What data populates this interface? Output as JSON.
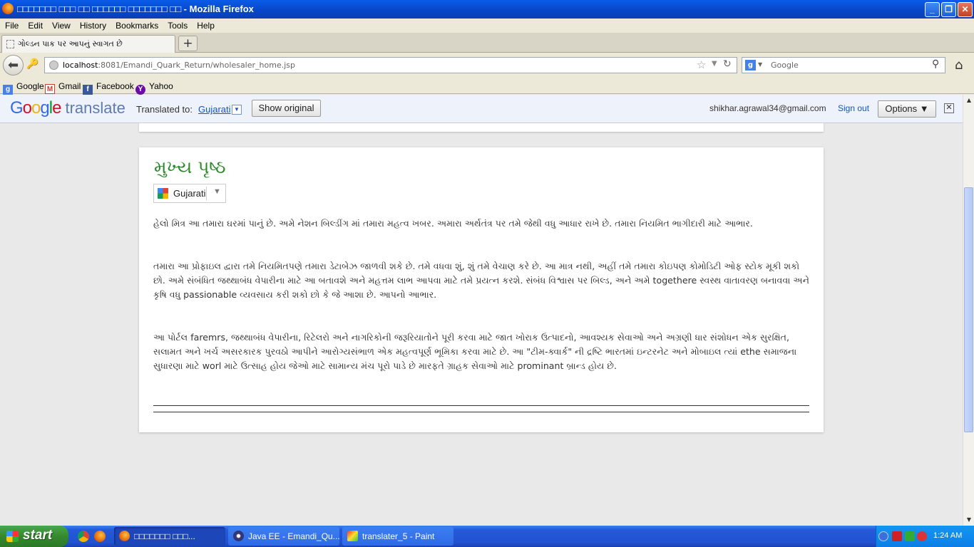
{
  "window": {
    "title": "□□□□□□□ □□□ □□ □□□□□□ □□□□□□□ □□ - Mozilla Firefox"
  },
  "menu": [
    "File",
    "Edit",
    "View",
    "History",
    "Bookmarks",
    "Tools",
    "Help"
  ],
  "tab": {
    "label": "ગોલ્ડન પાક પર આપનું સ્વાગત છે",
    "new_tab": "+"
  },
  "nav": {
    "url_host": "localhost",
    "url_path": ":8081/Emandi_Quark_Return/wholesaler_home.jsp",
    "search_placeholder": "Google"
  },
  "bookmarks": [
    {
      "label": "Google",
      "icon": "google-icon",
      "color": "#4a7fe6"
    },
    {
      "label": "Gmail",
      "icon": "gmail-icon",
      "color": "#d23a2c"
    },
    {
      "label": "Facebook",
      "icon": "facebook-icon",
      "color": "#3b5998"
    },
    {
      "label": "Yahoo",
      "icon": "yahoo-icon",
      "color": "#6a0ca8"
    }
  ],
  "translate_bar": {
    "logo_google": "Google",
    "logo_translate": "translate",
    "translated_to": "Translated to:",
    "language": "Gujarati",
    "show_original": "Show original",
    "email": "shikhar.agrawal34@gmail.com",
    "sign_out": "Sign out",
    "options": "Options ▼"
  },
  "page": {
    "title": "મુખ્ય પૃષ્ઠ",
    "language_gadget": "Gujarati",
    "paragraphs": [
      "હેલો મિત્ર આ તમારા ઘરમાં પાનું છે. અમે નેશન બિલ્ડીંગ માં તમારા મહત્વ ખબર. અમારા અર્થતંત્ર પર તમે જેથી વધુ આધાર રાખે છે. તમારા નિયમિત ભાગીદારી માટે આભાર.",
      "તમારા આ પ્રોફાઇલ દ્વારા તમે નિયમિતપણે તમારા ડેટાબેઝ જાળવી શકે છે. તમે વધવા શું, શું તમે વેચાણ કરે છે. આ માત્ર નથી, અહીં તમે તમારા કોઇપણ કોમોડિટી ઓફ સ્ટોક મૂકી શકો છો. અમે સંબંધિત જથ્થાબંધ વેપારીના માટે આ બતાવશે અને મહત્તમ લાભ આપવા માટે તમે પ્રયત્ન કરશે. સંબંધ વિશ્વાસ પર બિલ્ડ, અને અમે togethere સ્વસ્થ વાતાવરણ બનાવવા અને કૃષિ વધુ passionable વ્યવસાય કરી શકો છો કે જે આશા છે. આપનો આભાર.",
      "આ પોર્ટલ faremrs, જથ્થાબંધ વેપારીના, રિટેલરો અને નાગરિકોની જરૂરિયાતોને પૂરી કરવા માટે જાત ખોરાક ઉત્પાદનો, આવશ્યક સેવાઓ અને અગ્રણી ધાર સંશોધન એક સુરક્ષિત, સલામત અને ખર્ચ અસરકારક પુરવઠો આપીને આરોગ્યસંભાળ એક મહત્વપૂર્ણ ભૂમિકા કરવા માટે છે. આ \"ટીમ-ક્વાર્ક\" ની દ્રષ્ટિ ભારતમાં ઇન્ટરનેટ અને મોબાઇલ ત્યાં ethe સમાજના સુધારણા માટે worl માટે ઉત્સાહ હોય જેઓ માટે સામાન્ય મંચ પૂરો પાડે છે મારફતે ગ્રાહક સેવાઓ માટે prominant બ્રાન્ડ હોય છે."
    ]
  },
  "taskbar": {
    "start": "start",
    "tasks": [
      {
        "label": "□□□□□□□ □□□...",
        "icon": "firefox-icon"
      },
      {
        "label": "Java EE - Emandi_Qu...",
        "icon": "eclipse-icon"
      },
      {
        "label": "translater_5 - Paint",
        "icon": "paint-icon"
      }
    ],
    "clock": "1:24 AM"
  }
}
